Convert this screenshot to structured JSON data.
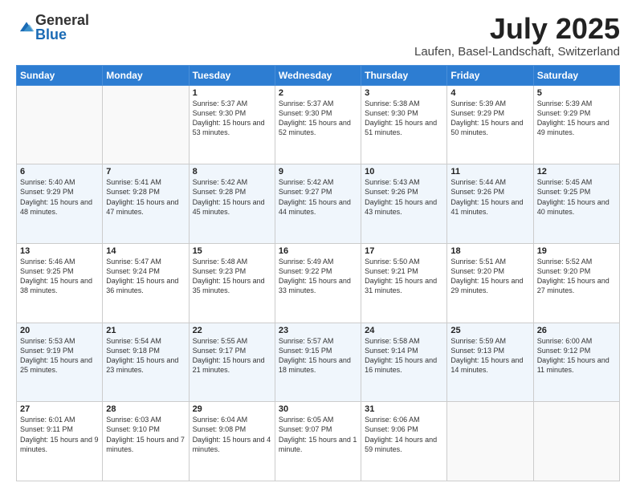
{
  "header": {
    "logo_general": "General",
    "logo_blue": "Blue",
    "month_title": "July 2025",
    "location": "Laufen, Basel-Landschaft, Switzerland"
  },
  "weekdays": [
    "Sunday",
    "Monday",
    "Tuesday",
    "Wednesday",
    "Thursday",
    "Friday",
    "Saturday"
  ],
  "weeks": [
    [
      {
        "day": "",
        "info": ""
      },
      {
        "day": "",
        "info": ""
      },
      {
        "day": "1",
        "info": "Sunrise: 5:37 AM\nSunset: 9:30 PM\nDaylight: 15 hours and 53 minutes."
      },
      {
        "day": "2",
        "info": "Sunrise: 5:37 AM\nSunset: 9:30 PM\nDaylight: 15 hours and 52 minutes."
      },
      {
        "day": "3",
        "info": "Sunrise: 5:38 AM\nSunset: 9:30 PM\nDaylight: 15 hours and 51 minutes."
      },
      {
        "day": "4",
        "info": "Sunrise: 5:39 AM\nSunset: 9:29 PM\nDaylight: 15 hours and 50 minutes."
      },
      {
        "day": "5",
        "info": "Sunrise: 5:39 AM\nSunset: 9:29 PM\nDaylight: 15 hours and 49 minutes."
      }
    ],
    [
      {
        "day": "6",
        "info": "Sunrise: 5:40 AM\nSunset: 9:29 PM\nDaylight: 15 hours and 48 minutes."
      },
      {
        "day": "7",
        "info": "Sunrise: 5:41 AM\nSunset: 9:28 PM\nDaylight: 15 hours and 47 minutes."
      },
      {
        "day": "8",
        "info": "Sunrise: 5:42 AM\nSunset: 9:28 PM\nDaylight: 15 hours and 45 minutes."
      },
      {
        "day": "9",
        "info": "Sunrise: 5:42 AM\nSunset: 9:27 PM\nDaylight: 15 hours and 44 minutes."
      },
      {
        "day": "10",
        "info": "Sunrise: 5:43 AM\nSunset: 9:26 PM\nDaylight: 15 hours and 43 minutes."
      },
      {
        "day": "11",
        "info": "Sunrise: 5:44 AM\nSunset: 9:26 PM\nDaylight: 15 hours and 41 minutes."
      },
      {
        "day": "12",
        "info": "Sunrise: 5:45 AM\nSunset: 9:25 PM\nDaylight: 15 hours and 40 minutes."
      }
    ],
    [
      {
        "day": "13",
        "info": "Sunrise: 5:46 AM\nSunset: 9:25 PM\nDaylight: 15 hours and 38 minutes."
      },
      {
        "day": "14",
        "info": "Sunrise: 5:47 AM\nSunset: 9:24 PM\nDaylight: 15 hours and 36 minutes."
      },
      {
        "day": "15",
        "info": "Sunrise: 5:48 AM\nSunset: 9:23 PM\nDaylight: 15 hours and 35 minutes."
      },
      {
        "day": "16",
        "info": "Sunrise: 5:49 AM\nSunset: 9:22 PM\nDaylight: 15 hours and 33 minutes."
      },
      {
        "day": "17",
        "info": "Sunrise: 5:50 AM\nSunset: 9:21 PM\nDaylight: 15 hours and 31 minutes."
      },
      {
        "day": "18",
        "info": "Sunrise: 5:51 AM\nSunset: 9:20 PM\nDaylight: 15 hours and 29 minutes."
      },
      {
        "day": "19",
        "info": "Sunrise: 5:52 AM\nSunset: 9:20 PM\nDaylight: 15 hours and 27 minutes."
      }
    ],
    [
      {
        "day": "20",
        "info": "Sunrise: 5:53 AM\nSunset: 9:19 PM\nDaylight: 15 hours and 25 minutes."
      },
      {
        "day": "21",
        "info": "Sunrise: 5:54 AM\nSunset: 9:18 PM\nDaylight: 15 hours and 23 minutes."
      },
      {
        "day": "22",
        "info": "Sunrise: 5:55 AM\nSunset: 9:17 PM\nDaylight: 15 hours and 21 minutes."
      },
      {
        "day": "23",
        "info": "Sunrise: 5:57 AM\nSunset: 9:15 PM\nDaylight: 15 hours and 18 minutes."
      },
      {
        "day": "24",
        "info": "Sunrise: 5:58 AM\nSunset: 9:14 PM\nDaylight: 15 hours and 16 minutes."
      },
      {
        "day": "25",
        "info": "Sunrise: 5:59 AM\nSunset: 9:13 PM\nDaylight: 15 hours and 14 minutes."
      },
      {
        "day": "26",
        "info": "Sunrise: 6:00 AM\nSunset: 9:12 PM\nDaylight: 15 hours and 11 minutes."
      }
    ],
    [
      {
        "day": "27",
        "info": "Sunrise: 6:01 AM\nSunset: 9:11 PM\nDaylight: 15 hours and 9 minutes."
      },
      {
        "day": "28",
        "info": "Sunrise: 6:03 AM\nSunset: 9:10 PM\nDaylight: 15 hours and 7 minutes."
      },
      {
        "day": "29",
        "info": "Sunrise: 6:04 AM\nSunset: 9:08 PM\nDaylight: 15 hours and 4 minutes."
      },
      {
        "day": "30",
        "info": "Sunrise: 6:05 AM\nSunset: 9:07 PM\nDaylight: 15 hours and 1 minute."
      },
      {
        "day": "31",
        "info": "Sunrise: 6:06 AM\nSunset: 9:06 PM\nDaylight: 14 hours and 59 minutes."
      },
      {
        "day": "",
        "info": ""
      },
      {
        "day": "",
        "info": ""
      }
    ]
  ]
}
